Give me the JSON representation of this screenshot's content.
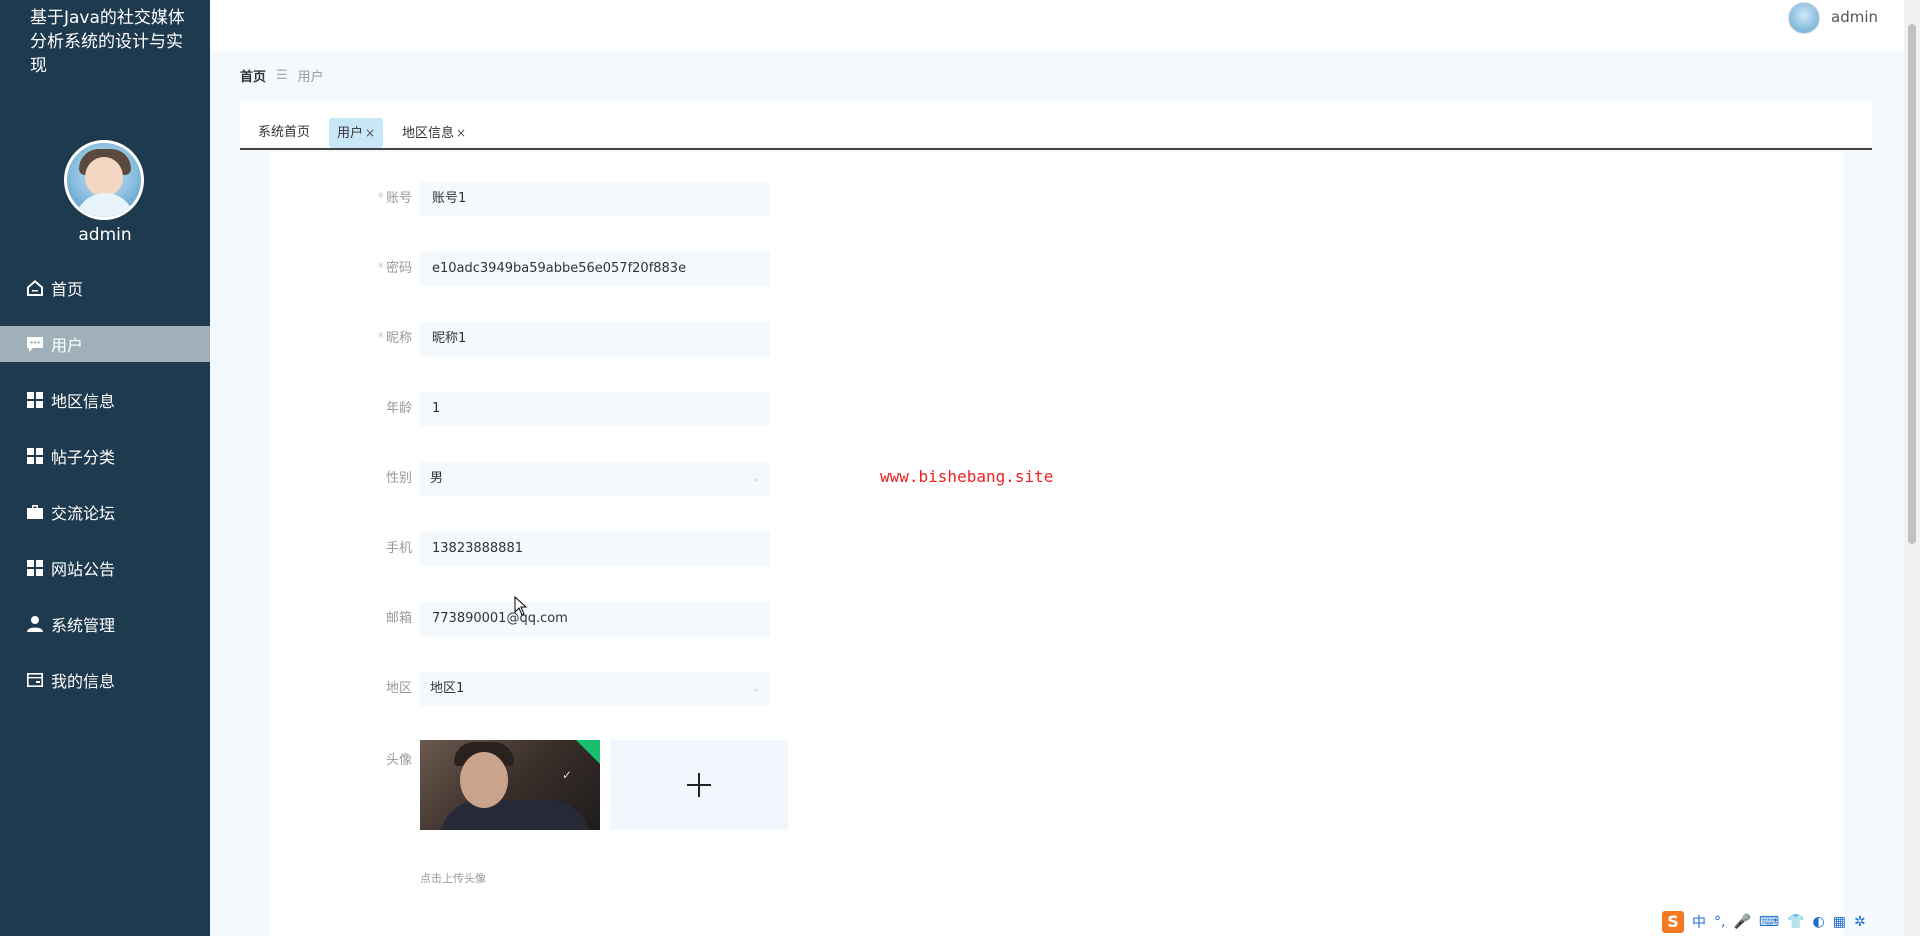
{
  "app": {
    "title": "基于Java的社交媒体分析系统的设计与实现"
  },
  "sidebar": {
    "username": "admin",
    "items": [
      {
        "label": "首页",
        "icon": "home-icon"
      },
      {
        "label": "用户",
        "icon": "chat-icon"
      },
      {
        "label": "地区信息",
        "icon": "grid-icon"
      },
      {
        "label": "帖子分类",
        "icon": "grid-icon"
      },
      {
        "label": "交流论坛",
        "icon": "briefcase-icon"
      },
      {
        "label": "网站公告",
        "icon": "grid-icon"
      },
      {
        "label": "系统管理",
        "icon": "user-icon"
      },
      {
        "label": "我的信息",
        "icon": "card-icon"
      }
    ]
  },
  "header": {
    "username": "admin"
  },
  "breadcrumb": {
    "home": "首页",
    "separator": "☰",
    "current": "用户"
  },
  "tabs": [
    {
      "label": "系统首页",
      "closable": false
    },
    {
      "label": "用户",
      "closable": true,
      "active": true
    },
    {
      "label": "地区信息",
      "closable": true
    }
  ],
  "tab_close_glyph": "×",
  "form": {
    "fields": [
      {
        "label": "账号",
        "required": true,
        "value": "账号1"
      },
      {
        "label": "密码",
        "required": true,
        "value": "e10adc3949ba59abbe56e057f20f883e"
      },
      {
        "label": "昵称",
        "required": true,
        "value": "昵称1"
      },
      {
        "label": "年龄",
        "required": false,
        "value": "1"
      },
      {
        "label": "性别",
        "required": false,
        "value": "男",
        "type": "select"
      },
      {
        "label": "手机",
        "required": false,
        "value": "13823888881"
      },
      {
        "label": "邮箱",
        "required": false,
        "value": "773890001@qq.com"
      },
      {
        "label": "地区",
        "required": false,
        "value": "地区1",
        "type": "select"
      }
    ],
    "avatar_label": "头像",
    "upload_hint": "点击上传头像",
    "required_mark": "*"
  },
  "watermark": "www.bishebang.site",
  "ime": {
    "logo": "S",
    "items": [
      "中",
      "°,",
      "🎤",
      "⌨",
      "👕",
      "◐",
      "▦",
      "✲"
    ]
  },
  "colors": {
    "sidebar_bg": "#1e3a4e",
    "active_menu": "#9fb0ba",
    "active_tab": "#c8e6f5",
    "watermark": "#e22222"
  }
}
